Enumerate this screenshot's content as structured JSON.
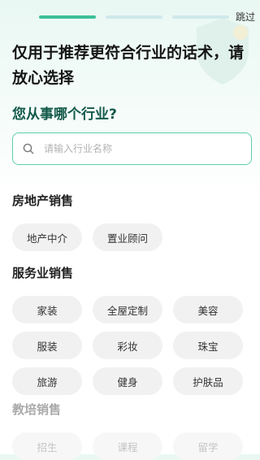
{
  "header": {
    "progress": {
      "total_steps": 3,
      "current_step": 1
    },
    "skip_label": "跳过"
  },
  "main": {
    "title": "仅用于推荐更符合行业的话术，请放心选择",
    "question": "您从事哪个行业?",
    "search": {
      "placeholder": "请输入行业名称",
      "value": ""
    }
  },
  "categories": [
    {
      "title": "房地产销售",
      "items": [
        "地产中介",
        "置业顾问"
      ]
    },
    {
      "title": "服务业销售",
      "items": [
        "家装",
        "全屋定制",
        "美容",
        "服装",
        "彩妆",
        "珠宝",
        "旅游",
        "健身",
        "护肤品"
      ]
    },
    {
      "title": "教培销售",
      "items": [
        "招生",
        "课程",
        "留学"
      ]
    }
  ],
  "colors": {
    "accent": "#3dbf9a",
    "progress_inactive": "#cfe9ea",
    "question_text": "#13594a",
    "chip_bg": "#f1f1f1"
  }
}
